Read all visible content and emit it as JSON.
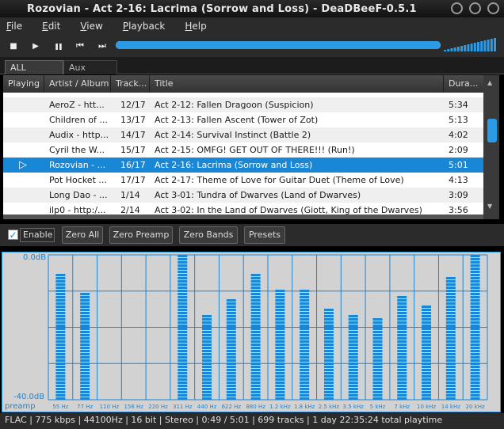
{
  "window": {
    "title": "Rozovian - Act 2-16: Lacrima (Sorrow and Loss) - DeaDBeeF-0.5.1"
  },
  "menu": [
    {
      "pre": "",
      "ul": "F",
      "post": "ile"
    },
    {
      "pre": "",
      "ul": "E",
      "post": "dit"
    },
    {
      "pre": "",
      "ul": "V",
      "post": "iew"
    },
    {
      "pre": "",
      "ul": "P",
      "post": "layback"
    },
    {
      "pre": "",
      "ul": "H",
      "post": "elp"
    }
  ],
  "toolbar": {
    "stop": "■",
    "play": "▶",
    "pause": "❚❚",
    "prev": "⏮",
    "next": "⏭",
    "seek_progress": 1.0
  },
  "tabs": [
    {
      "label": "ALL"
    },
    {
      "label": "Aux"
    }
  ],
  "playlist": {
    "columns": [
      "Playing",
      "Artist / Album",
      "Track...",
      "Title",
      "Dura..."
    ],
    "rows": [
      {
        "playing": "",
        "artist": "AeroZ - htt...",
        "track": "12/17",
        "title": "Act 2-12: Fallen Dragoon (Suspicion)",
        "duration": "5:34"
      },
      {
        "playing": "",
        "artist": "Children of ...",
        "track": "13/17",
        "title": "Act 2-13: Fallen Ascent (Tower of Zot)",
        "duration": "5:13"
      },
      {
        "playing": "",
        "artist": "Audix - http...",
        "track": "14/17",
        "title": "Act 2-14: Survival Instinct (Battle 2)",
        "duration": "4:02"
      },
      {
        "playing": "",
        "artist": "Cyril the W...",
        "track": "15/17",
        "title": "Act 2-15: OMFG! GET OUT OF THERE!!! (Run!)",
        "duration": "2:09"
      },
      {
        "playing": "▷",
        "artist": "Rozovian - ...",
        "track": "16/17",
        "title": "Act 2-16: Lacrima (Sorrow and Loss)",
        "duration": "5:01"
      },
      {
        "playing": "",
        "artist": "Pot Hocket ...",
        "track": "17/17",
        "title": "Act 2-17: Theme of Love for Guitar Duet (Theme of Love)",
        "duration": "4:13"
      },
      {
        "playing": "",
        "artist": "Long Dao - ...",
        "track": "1/14",
        "title": "Act 3-01: Tundra of Dwarves (Land of Dwarves)",
        "duration": "3:09"
      },
      {
        "playing": "",
        "artist": "ilp0 - http:/...",
        "track": "2/14",
        "title": "Act 3-02: In the Land of Dwarves (Giott, King of the Dwarves)",
        "duration": "3:56"
      }
    ],
    "selected_index": 4
  },
  "eq_controls": {
    "enable": "Enable",
    "zero_all": "Zero All",
    "zero_preamp": "Zero Preamp",
    "zero_bands": "Zero Bands",
    "presets": "Presets"
  },
  "equalizer": {
    "top_label": "0.0dB",
    "bottom_label": "-40.0dB",
    "preamp_label": "preamp",
    "bands": [
      {
        "freq": "55 Hz",
        "level": 0.88
      },
      {
        "freq": "77 Hz",
        "level": 0.74
      },
      {
        "freq": "110 Hz",
        "level": 0.0
      },
      {
        "freq": "156 Hz",
        "level": 0.0
      },
      {
        "freq": "220 Hz",
        "level": 0.0
      },
      {
        "freq": "311 Hz",
        "level": 1.0
      },
      {
        "freq": "440 Hz",
        "level": 0.6
      },
      {
        "freq": "622 Hz",
        "level": 0.71
      },
      {
        "freq": "880 Hz",
        "level": 0.88
      },
      {
        "freq": "1.2 kHz",
        "level": 0.78
      },
      {
        "freq": "1.8 kHz",
        "level": 0.78
      },
      {
        "freq": "2.5 kHz",
        "level": 0.65
      },
      {
        "freq": "3.5 kHz",
        "level": 0.6
      },
      {
        "freq": "5 kHz",
        "level": 0.57
      },
      {
        "freq": "7 kHz",
        "level": 0.73
      },
      {
        "freq": "10 kHz",
        "level": 0.67
      },
      {
        "freq": "14 kHz",
        "level": 0.86
      },
      {
        "freq": "20 kHz",
        "level": 1.0
      }
    ],
    "accent": "#1a86d6"
  },
  "status": {
    "text": "FLAC |  775 kbps | 44100Hz | 16 bit | Stereo | 0:49 / 5:01 | 699 tracks | 1 day 22:35:24 total playtime"
  }
}
